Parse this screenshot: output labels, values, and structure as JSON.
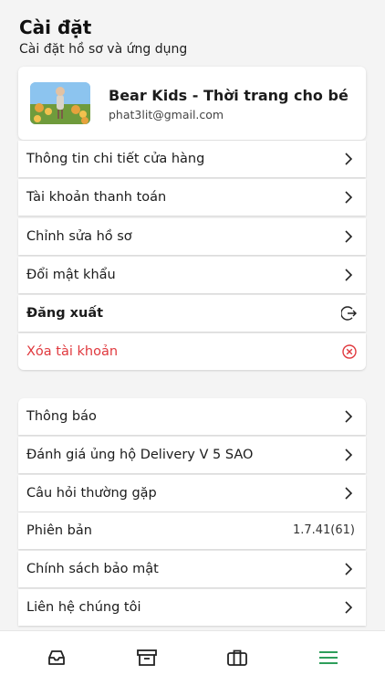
{
  "header": {
    "title": "Cài đặt",
    "subtitle": "Cài đặt hồ sơ và ứng dụng"
  },
  "profile": {
    "name": "Bear Kids - Thời trang cho bé",
    "email": "phat3lit@gmail.com"
  },
  "account_menu": [
    {
      "label": "Thông tin chi tiết cửa hàng",
      "icon": "chevron-right-icon"
    },
    {
      "label": "Tài khoản thanh toán",
      "icon": "chevron-right-icon"
    },
    {
      "label": "Chỉnh sửa hồ sơ",
      "icon": "chevron-right-icon"
    },
    {
      "label": "Đổi mật khẩu",
      "icon": "chevron-right-icon"
    },
    {
      "label": "Đăng xuất",
      "icon": "logout-icon"
    },
    {
      "label": "Xóa tài khoản",
      "icon": "delete-circle-icon"
    }
  ],
  "app_menu": [
    {
      "label": "Thông báo",
      "icon": "chevron-right-icon"
    },
    {
      "label": "Đánh giá ủng hộ Delivery V 5 SAO",
      "icon": "chevron-right-icon"
    },
    {
      "label": "Câu hỏi thường gặp",
      "icon": "chevron-right-icon"
    },
    {
      "label": "Phiên bản",
      "value": "1.7.41(61)"
    },
    {
      "label": "Chính sách bảo mật",
      "icon": "chevron-right-icon"
    },
    {
      "label": "Liên hệ chúng tôi",
      "icon": "chevron-right-icon"
    }
  ],
  "bottom_nav": [
    {
      "icon": "inbox-icon",
      "active": false
    },
    {
      "icon": "archive-icon",
      "active": false
    },
    {
      "icon": "briefcase-icon",
      "active": false
    },
    {
      "icon": "menu-icon",
      "active": true
    }
  ],
  "colors": {
    "accent": "#2e9e5b",
    "danger": "#e0393e",
    "background": "#f4f4f4"
  }
}
